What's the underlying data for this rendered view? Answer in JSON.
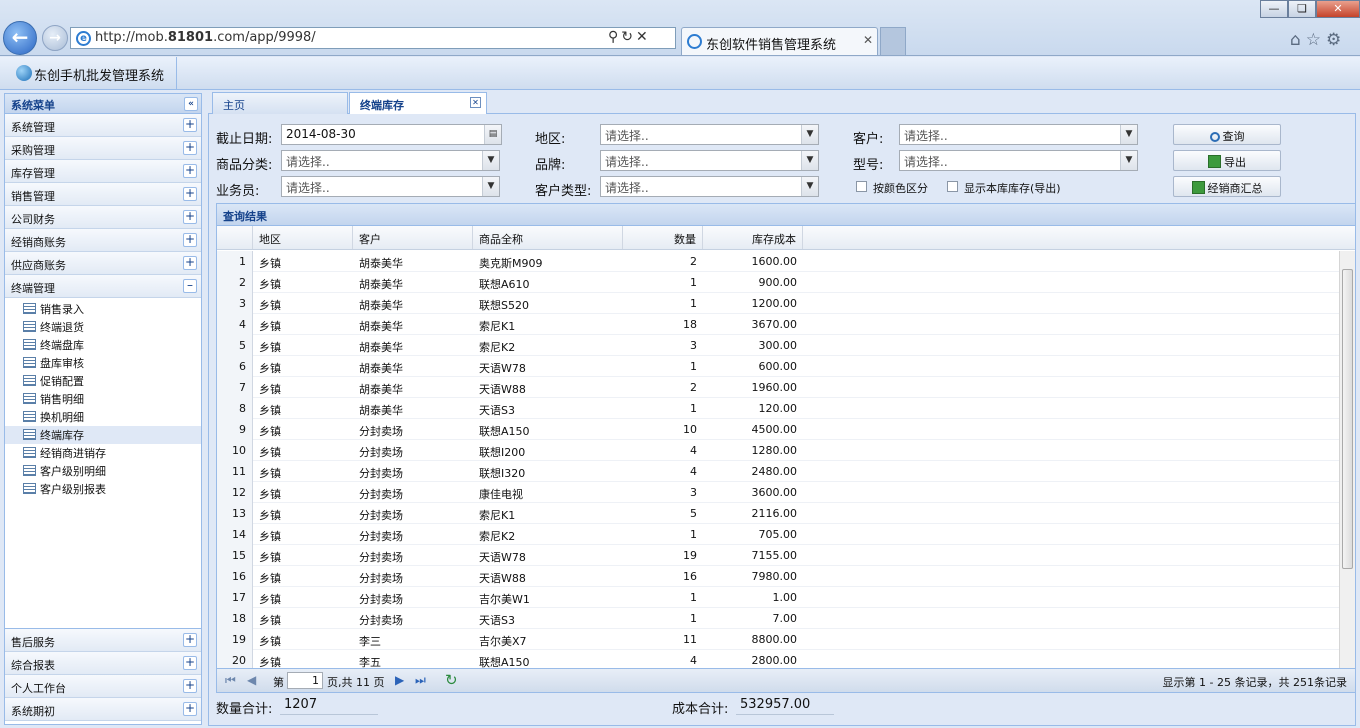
{
  "browser": {
    "url_prefix": "http://mob.",
    "url_domain": "81801",
    "url_suffix": ".com/app/9998/",
    "tab_title": "东创软件销售管理系统",
    "back_icon": "back-arrow-icon",
    "forward_icon": "forward-arrow-icon"
  },
  "app": {
    "title": "东创手机批发管理系统"
  },
  "sidebar": {
    "header": "系统菜单",
    "groups_top": [
      {
        "label": "系统管理"
      },
      {
        "label": "采购管理"
      },
      {
        "label": "库存管理"
      },
      {
        "label": "销售管理"
      },
      {
        "label": "公司财务"
      },
      {
        "label": "经销商账务"
      },
      {
        "label": "供应商账务"
      }
    ],
    "expanded_group": "终端管理",
    "sub_items": [
      {
        "label": "销售录入"
      },
      {
        "label": "终端退货"
      },
      {
        "label": "终端盘库"
      },
      {
        "label": "盘库审核"
      },
      {
        "label": "促销配置"
      },
      {
        "label": "销售明细"
      },
      {
        "label": "换机明细"
      },
      {
        "label": "终端库存"
      },
      {
        "label": "经销商进销存"
      },
      {
        "label": "客户级别明细"
      },
      {
        "label": "客户级别报表"
      }
    ],
    "groups_bottom": [
      {
        "label": "售后服务"
      },
      {
        "label": "综合报表"
      },
      {
        "label": "个人工作台"
      },
      {
        "label": "系统期初"
      }
    ]
  },
  "tabs": {
    "home": "主页",
    "active": "终端库存"
  },
  "filters": {
    "date_label": "截止日期:",
    "date_value": "2014-08-30",
    "region_label": "地区:",
    "customer_label": "客户:",
    "category_label": "商品分类:",
    "brand_label": "品牌:",
    "model_label": "型号:",
    "salesman_label": "业务员:",
    "customer_type_label": "客户类型:",
    "placeholder": "请选择..",
    "color_check_label": "按颜色区分",
    "show_store_label": "显示本库库存(导出)"
  },
  "buttons": {
    "query": "查询",
    "export": "导出",
    "dealer_summary": "经销商汇总"
  },
  "grid": {
    "title": "查询结果",
    "columns": [
      "地区",
      "客户",
      "商品全称",
      "数量",
      "库存成本"
    ],
    "rows": [
      [
        "1",
        "乡镇",
        "胡泰美华",
        "奥克斯M909",
        "2",
        "1600.00"
      ],
      [
        "2",
        "乡镇",
        "胡泰美华",
        "联想A610",
        "1",
        "900.00"
      ],
      [
        "3",
        "乡镇",
        "胡泰美华",
        "联想S520",
        "1",
        "1200.00"
      ],
      [
        "4",
        "乡镇",
        "胡泰美华",
        "索尼K1",
        "18",
        "3670.00"
      ],
      [
        "5",
        "乡镇",
        "胡泰美华",
        "索尼K2",
        "3",
        "300.00"
      ],
      [
        "6",
        "乡镇",
        "胡泰美华",
        "天语W78",
        "1",
        "600.00"
      ],
      [
        "7",
        "乡镇",
        "胡泰美华",
        "天语W88",
        "2",
        "1960.00"
      ],
      [
        "8",
        "乡镇",
        "胡泰美华",
        "天语S3",
        "1",
        "120.00"
      ],
      [
        "9",
        "乡镇",
        "分封卖场",
        "联想A150",
        "10",
        "4500.00"
      ],
      [
        "10",
        "乡镇",
        "分封卖场",
        "联想I200",
        "4",
        "1280.00"
      ],
      [
        "11",
        "乡镇",
        "分封卖场",
        "联想I320",
        "4",
        "2480.00"
      ],
      [
        "12",
        "乡镇",
        "分封卖场",
        "康佳电视",
        "3",
        "3600.00"
      ],
      [
        "13",
        "乡镇",
        "分封卖场",
        "索尼K1",
        "5",
        "2116.00"
      ],
      [
        "14",
        "乡镇",
        "分封卖场",
        "索尼K2",
        "1",
        "705.00"
      ],
      [
        "15",
        "乡镇",
        "分封卖场",
        "天语W78",
        "19",
        "7155.00"
      ],
      [
        "16",
        "乡镇",
        "分封卖场",
        "天语W88",
        "16",
        "7980.00"
      ],
      [
        "17",
        "乡镇",
        "分封卖场",
        "吉尔美W1",
        "1",
        "1.00"
      ],
      [
        "18",
        "乡镇",
        "分封卖场",
        "天语S3",
        "1",
        "7.00"
      ],
      [
        "19",
        "乡镇",
        "李三",
        "吉尔美X7",
        "11",
        "8800.00"
      ],
      [
        "20",
        "乡镇",
        "李五",
        "联想A150",
        "4",
        "2800.00"
      ]
    ]
  },
  "pager": {
    "page_label": "第",
    "page_value": "1",
    "page_of": "页,共 11 页",
    "summary": "显示第 1 - 25 条记录，共 251条记录"
  },
  "totals": {
    "qty_label": "数量合计:",
    "qty_value": "1207",
    "cost_label": "成本合计:",
    "cost_value": "532957.00"
  }
}
